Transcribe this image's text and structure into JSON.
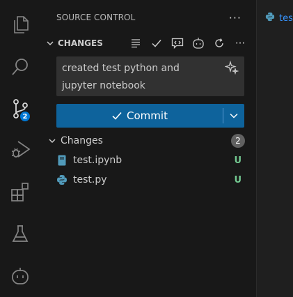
{
  "activity_bar": {
    "items": [
      {
        "name": "explorer",
        "icon": "files-icon"
      },
      {
        "name": "search",
        "icon": "search-icon"
      },
      {
        "name": "source-control",
        "icon": "source-control-icon",
        "badge": "2"
      },
      {
        "name": "run-debug",
        "icon": "run-debug-icon"
      },
      {
        "name": "extensions",
        "icon": "extensions-icon"
      },
      {
        "name": "testing",
        "icon": "beaker-icon"
      },
      {
        "name": "copilot",
        "icon": "robot-icon"
      }
    ]
  },
  "sidebar": {
    "title": "SOURCE CONTROL",
    "section_title": "CHANGES",
    "commit_message": "created test python and jupyter notebook",
    "commit_label": "Commit",
    "group": {
      "label": "Changes",
      "count": "2",
      "files": [
        {
          "name": "test.ipynb",
          "status": "U",
          "icon": "notebook-icon"
        },
        {
          "name": "test.py",
          "status": "U",
          "icon": "python-icon"
        }
      ]
    }
  },
  "editor": {
    "tab_label": "tes"
  },
  "colors": {
    "accent": "#0e639c",
    "badge": "#0078d4",
    "untracked": "#73c991"
  }
}
